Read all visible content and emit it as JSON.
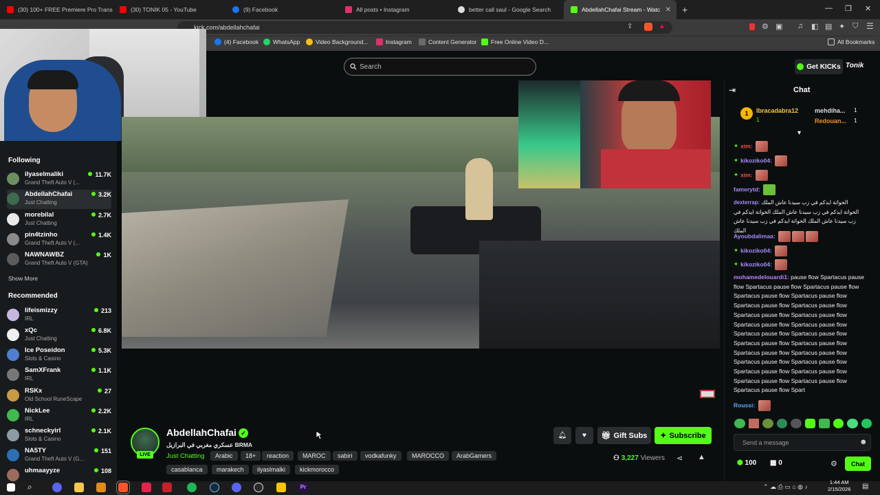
{
  "tabs": [
    {
      "label": "(30) 100+ FREE Premiere Pro Transiti...",
      "color": "#ff0000"
    },
    {
      "label": "(30) TONIK 05 - YouTube",
      "color": "#ff0000"
    },
    {
      "label": "(9) Facebook",
      "color": "#1877f2"
    },
    {
      "label": "All posts • Instagram",
      "color": "#e1306c"
    },
    {
      "label": "better call saul - Google Search",
      "color": "#dddddd"
    },
    {
      "label": "AbdellahChafai Stream - Watc",
      "color": "#53fc18"
    }
  ],
  "address": {
    "url": "kick.com/abdellahchafai"
  },
  "bookmarks": [
    {
      "label": "(4) Facebook",
      "color": "#1877f2"
    },
    {
      "label": "WhatsApp",
      "color": "#25d366"
    },
    {
      "label": "Video Background...",
      "color": "#f4c20d"
    },
    {
      "label": "Instagram",
      "color": "#e1306c"
    },
    {
      "label": "Content Generator",
      "color": "#6b6b6b"
    },
    {
      "label": "Free Online Video D...",
      "color": "#53fc18"
    }
  ],
  "all_bookmarks": "All Bookmarks",
  "header": {
    "search_placeholder": "Search",
    "get_kicks": "Get KICKs",
    "brand": "Tonik"
  },
  "sidebar": {
    "following_title": "Following",
    "following": [
      {
        "name": "ilyaselmaliki",
        "game": "Grand Theft Auto V (...",
        "viewers": "11.7K",
        "color": "#6b8f5e"
      },
      {
        "name": "AbdellahChafai",
        "game": "Just Chatting",
        "viewers": "3.2K",
        "color": "#3e6b4f"
      },
      {
        "name": "morebilal",
        "game": "Just Chatting",
        "viewers": "2.7K",
        "color": "#e9e9e9"
      },
      {
        "name": "pin4tzinho",
        "game": "Grand Theft Auto V (...",
        "viewers": "1.4K",
        "color": "#8a8a8a"
      },
      {
        "name": "NAWNAWBZ",
        "game": "Grand Theft Auto V (GTA)",
        "viewers": "1K",
        "color": "#5b5b5b"
      }
    ],
    "show_more": "Show More",
    "recommended_title": "Recommended",
    "recommended": [
      {
        "name": "lifeismizzy",
        "game": "IRL",
        "viewers": "213",
        "color": "#c7b7e0"
      },
      {
        "name": "xQc",
        "game": "Just Chatting",
        "viewers": "6.8K",
        "color": "#f0f0f0"
      },
      {
        "name": "Ice Poseidon",
        "game": "Slots & Casino",
        "viewers": "5.3K",
        "color": "#4e7fd0"
      },
      {
        "name": "SamXFrank",
        "game": "IRL",
        "viewers": "1.1K",
        "color": "#777777"
      },
      {
        "name": "RSKx",
        "game": "Old School RuneScape",
        "viewers": "27",
        "color": "#c79a46"
      },
      {
        "name": "NickLee",
        "game": "IRL",
        "viewers": "2.2K",
        "color": "#3fb950"
      },
      {
        "name": "schneckyirl",
        "game": "Slots & Casino",
        "viewers": "2.1K",
        "color": "#8c9aa6"
      },
      {
        "name": "NA5TY",
        "game": "Grand Theft Auto V (G...",
        "viewers": "151",
        "color": "#2d6fb5"
      },
      {
        "name": "uhmaayyze",
        "game": "",
        "viewers": "108",
        "color": "#9c6b5b"
      }
    ]
  },
  "stream": {
    "name": "AbdellahChafai",
    "title": "عسكري مغربي في البرازيل BRMA",
    "category": "Just Chatting",
    "live": "LIVE",
    "tags_row1": [
      "Arabic",
      "18+",
      "reaction",
      "MAROC",
      "sabiri",
      "vodkafunky",
      "MAROCCO",
      "ArabGamers"
    ],
    "tags_row2": [
      "casablanca",
      "marakech",
      "ilyaslmalki",
      "kickmorocco"
    ],
    "gift_subs": "Gift Subs",
    "subscribe": "Subscribe",
    "viewers": "3,227",
    "viewers_label": "Viewers"
  },
  "chat": {
    "title": "Chat",
    "pinned": [
      {
        "name": "Ibracadabra12",
        "count": "1"
      },
      {
        "name": "mehdiha...",
        "count": "1"
      },
      {
        "name": "Redouan...",
        "count": "1"
      }
    ],
    "messages": [
      {
        "user": "xim:",
        "text": "",
        "user_color": "#ff4d4d",
        "badge": true,
        "emotes": 1
      },
      {
        "user": "kikoziko04:",
        "text": "",
        "user_color": "#a78bfa",
        "badge": true,
        "emotes": 1
      },
      {
        "user": "xim:",
        "text": "",
        "user_color": "#ff4d4d",
        "badge": true,
        "emotes": 1
      },
      {
        "user": "famerytd:",
        "text": "",
        "user_color": "#a78bfa",
        "badge": false,
        "emotes": 1
      },
      {
        "user": "dexterrap:",
        "text": "الخواتة ايدكم في زب سيدنا عاش الملك الخواتة ايدكم في زب سيدنا عاش الملك الخواتة ايدكم في زب سيدنا عاش الملك الخواتة ايدكم في زب سيدنا عاش الملك",
        "user_color": "#a78bfa",
        "badge": false,
        "emotes": 0
      },
      {
        "user": "Ayoubdalimaa:",
        "text": "",
        "user_color": "#a78bfa",
        "badge": false,
        "emotes": 3
      },
      {
        "user": "kikoziko04:",
        "text": "",
        "user_color": "#a78bfa",
        "badge": true,
        "emotes": 1
      },
      {
        "user": "kikoziko04:",
        "text": "",
        "user_color": "#a78bfa",
        "badge": true,
        "emotes": 1
      },
      {
        "user": "mohamedelouardi1:",
        "text": "pause flow Spartacus pause flow Spartacus pause flow Spartacus pause flow Spartacus pause flow Spartacus pause flow Spartacus pause flow Spartacus pause flow Spartacus pause flow Spartacus pause flow Spartacus pause flow Spartacus pause flow Spartacus pause flow Spartacus pause flow Spartacus pause flow Spartacus pause flow Spartacus pause flow Spartacus pause flow Spartacus pause flow Spartacus pause flow Spartacus pause flow Spartacus pause flow Spartacus pause flow Spartacus pause flow Spartacus pause flow Spart",
        "user_color": "#c084fc",
        "badge": false,
        "emotes": 0
      },
      {
        "user": "Roussi:",
        "text": "",
        "user_color": "#60a5fa",
        "badge": false,
        "emotes": 1
      }
    ],
    "input_placeholder": "Send a message",
    "points": "100",
    "gifts": "0",
    "send_label": "Chat"
  },
  "taskbar": {
    "time": "1:44 AM",
    "date": "2/15/2026"
  }
}
